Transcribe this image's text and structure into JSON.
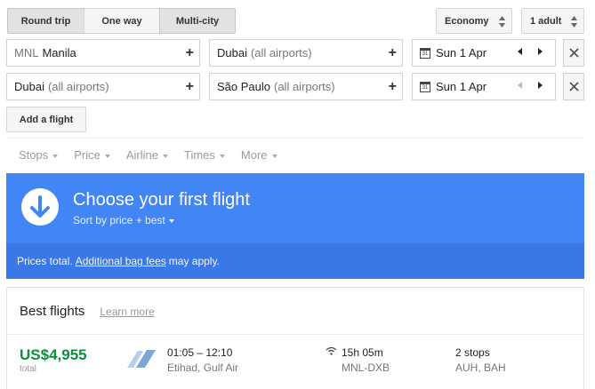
{
  "trip_types": [
    "Round trip",
    "One way",
    "Multi-city"
  ],
  "cabin": "Economy",
  "passengers": "1 adult",
  "legs": [
    {
      "origin_code": "MNL",
      "origin_name": "Manila",
      "origin_note": "",
      "destination": "Dubai",
      "destination_note": "(all airports)",
      "date": "Sun 1 Apr"
    },
    {
      "origin_code": "",
      "origin_name": "Dubai",
      "origin_note": "(all airports)",
      "destination": "São Paulo",
      "destination_note": "(all airports)",
      "date": "Sun 1 Apr"
    }
  ],
  "add_flight": "Add a flight",
  "filters": [
    "Stops",
    "Price",
    "Airline",
    "Times",
    "More"
  ],
  "banner": {
    "title": "Choose your first flight",
    "sort": "Sort by price + best",
    "note_prefix": "Prices total.",
    "note_link": "Additional bag fees",
    "note_suffix": "may apply."
  },
  "best": {
    "title": "Best flights",
    "learn_more": "Learn more",
    "flight": {
      "price": "US$4,955",
      "price_sub": "total",
      "times": "01:05 – 12:10",
      "airlines": "Etihad, Gulf Air",
      "duration": "15h 05m",
      "route": "MNL-DXB",
      "stops": "2 stops",
      "via": "AUH, BAH"
    }
  },
  "colors": {
    "accent": "#4285f4",
    "banner_dark": "#3b78e7",
    "price": "#0a8f3c"
  },
  "icons": [
    "swap-arrows-icon",
    "plus-icon",
    "calendar-icon",
    "prev-date-icon",
    "next-date-icon",
    "close-icon",
    "down-arrow-icon",
    "wifi-icon",
    "airline-logo-icon"
  ]
}
